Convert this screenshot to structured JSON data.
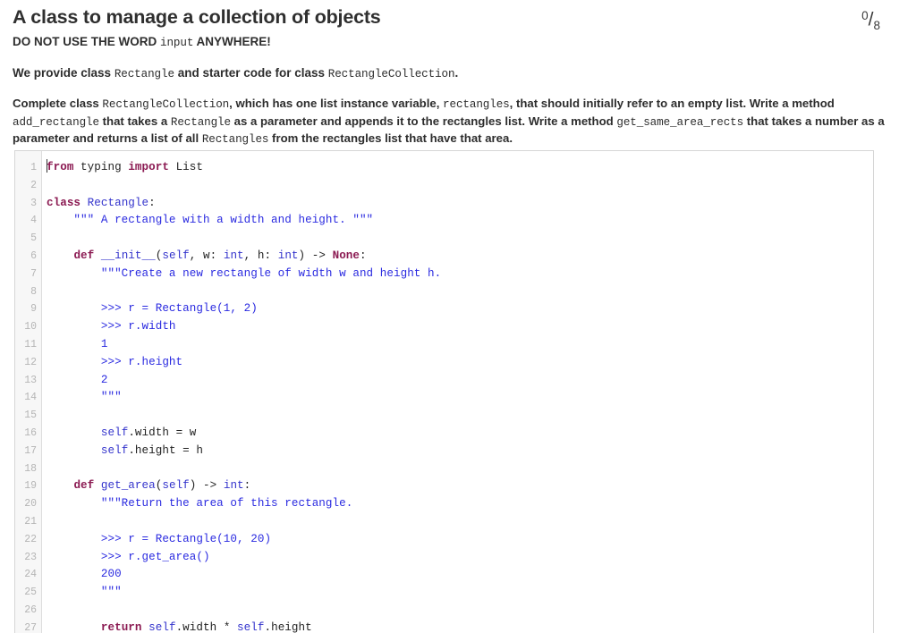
{
  "header": {
    "title": "A class to manage a collection of objects",
    "score": {
      "numerator": "0",
      "separator": "/",
      "denominator": "8"
    },
    "warning": {
      "prefix": "DO NOT USE THE WORD ",
      "code": "input",
      "suffix": " ANYWHERE!"
    },
    "intro": {
      "p1": "We provide class ",
      "c1": "Rectangle",
      "p2": " and starter code for class ",
      "c2": "RectangleCollection",
      "p3": "."
    },
    "description": {
      "t1": "Complete class ",
      "c1": "RectangleCollection",
      "t2": ", which has one list instance variable, ",
      "c2": "rectangles",
      "t3": ", that should initially refer to an empty list. Write a method ",
      "c3": "add_rectangle",
      "t4": " that takes a ",
      "c4": "Rectangle",
      "t5": " as a parameter and appends it to the rectangles list. Write a method ",
      "c5": "get_same_area_rects",
      "t6": " that takes a number as a parameter and returns a list of all ",
      "c6": "Rectangles",
      "t7": " from the rectangles list that have that area."
    }
  },
  "editor": {
    "line_numbers": [
      "1",
      "2",
      "3",
      "4",
      "5",
      "6",
      "7",
      "8",
      "9",
      "10",
      "11",
      "12",
      "13",
      "14",
      "15",
      "16",
      "17",
      "18",
      "19",
      "20",
      "21",
      "22",
      "23",
      "24",
      "25",
      "26",
      "27"
    ],
    "lines": [
      [
        {
          "t": "from",
          "c": "kw"
        },
        {
          "t": " typing ",
          "c": "plain"
        },
        {
          "t": "import",
          "c": "kw"
        },
        {
          "t": " List",
          "c": "plain"
        }
      ],
      [],
      [
        {
          "t": "class",
          "c": "kw"
        },
        {
          "t": " ",
          "c": "plain"
        },
        {
          "t": "Rectangle",
          "c": "name"
        },
        {
          "t": ":",
          "c": "plain"
        }
      ],
      [
        {
          "t": "    \"\"\" A rectangle with a width and height. \"\"\"",
          "c": "doc"
        }
      ],
      [],
      [
        {
          "t": "    ",
          "c": "plain"
        },
        {
          "t": "def",
          "c": "kw"
        },
        {
          "t": " ",
          "c": "plain"
        },
        {
          "t": "__init__",
          "c": "name"
        },
        {
          "t": "(",
          "c": "plain"
        },
        {
          "t": "self",
          "c": "bi"
        },
        {
          "t": ", w: ",
          "c": "plain"
        },
        {
          "t": "int",
          "c": "bi"
        },
        {
          "t": ", h: ",
          "c": "plain"
        },
        {
          "t": "int",
          "c": "bi"
        },
        {
          "t": ") -> ",
          "c": "plain"
        },
        {
          "t": "None",
          "c": "kw"
        },
        {
          "t": ":",
          "c": "plain"
        }
      ],
      [
        {
          "t": "        \"\"\"Create a new rectangle of width w and height h.",
          "c": "doc"
        }
      ],
      [],
      [
        {
          "t": "        >>> r = Rectangle(1, 2)",
          "c": "doc"
        }
      ],
      [
        {
          "t": "        >>> r.width",
          "c": "doc"
        }
      ],
      [
        {
          "t": "        1",
          "c": "doc"
        }
      ],
      [
        {
          "t": "        >>> r.height",
          "c": "doc"
        }
      ],
      [
        {
          "t": "        2",
          "c": "doc"
        }
      ],
      [
        {
          "t": "        \"\"\"",
          "c": "doc"
        }
      ],
      [],
      [
        {
          "t": "        ",
          "c": "plain"
        },
        {
          "t": "self",
          "c": "bi"
        },
        {
          "t": ".width = w",
          "c": "plain"
        }
      ],
      [
        {
          "t": "        ",
          "c": "plain"
        },
        {
          "t": "self",
          "c": "bi"
        },
        {
          "t": ".height = h",
          "c": "plain"
        }
      ],
      [],
      [
        {
          "t": "    ",
          "c": "plain"
        },
        {
          "t": "def",
          "c": "kw"
        },
        {
          "t": " ",
          "c": "plain"
        },
        {
          "t": "get_area",
          "c": "name"
        },
        {
          "t": "(",
          "c": "plain"
        },
        {
          "t": "self",
          "c": "bi"
        },
        {
          "t": ") -> ",
          "c": "plain"
        },
        {
          "t": "int",
          "c": "bi"
        },
        {
          "t": ":",
          "c": "plain"
        }
      ],
      [
        {
          "t": "        \"\"\"Return the area of this rectangle.",
          "c": "doc"
        }
      ],
      [],
      [
        {
          "t": "        >>> r = Rectangle(10, 20)",
          "c": "doc"
        }
      ],
      [
        {
          "t": "        >>> r.get_area()",
          "c": "doc"
        }
      ],
      [
        {
          "t": "        200",
          "c": "doc"
        }
      ],
      [
        {
          "t": "        \"\"\"",
          "c": "doc"
        }
      ],
      [],
      [
        {
          "t": "        ",
          "c": "plain"
        },
        {
          "t": "return",
          "c": "kw"
        },
        {
          "t": " ",
          "c": "plain"
        },
        {
          "t": "self",
          "c": "bi"
        },
        {
          "t": ".width * ",
          "c": "plain"
        },
        {
          "t": "self",
          "c": "bi"
        },
        {
          "t": ".height",
          "c": "plain"
        }
      ]
    ]
  },
  "colors": {
    "keyword": "#8b1a52",
    "builtin": "#3333cc",
    "docstring": "#2a2ae0",
    "plain": "#222222",
    "gutter_text": "#b5b5b5",
    "gutter_bg": "#f7f7f7",
    "border": "#d6d6d6"
  }
}
